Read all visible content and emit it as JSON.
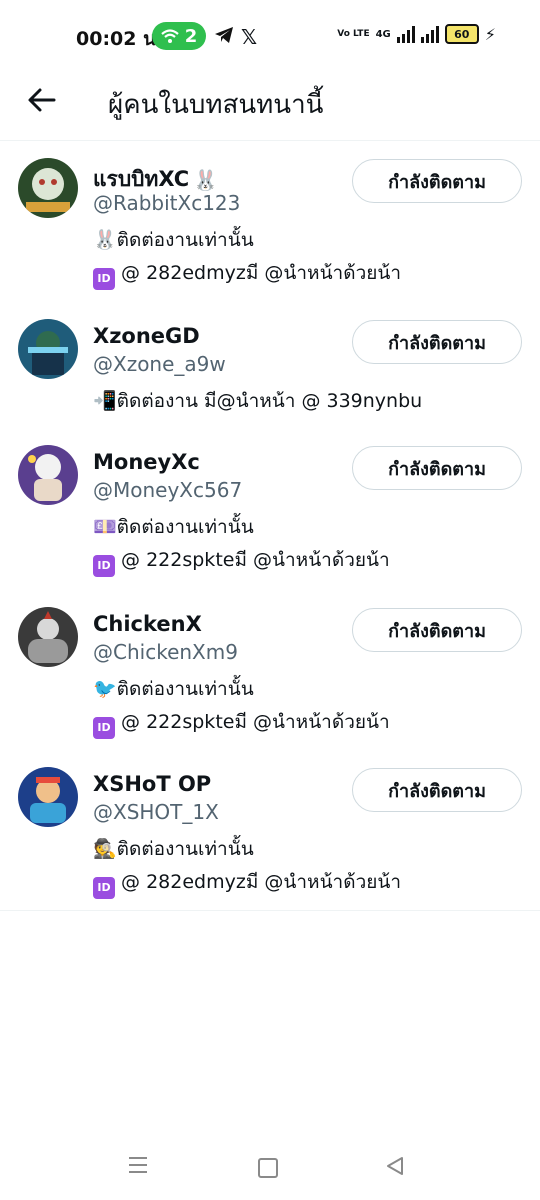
{
  "status_bar": {
    "time": "00:02 น.",
    "hotspot_count": "2",
    "volte": "Vo LTE",
    "network": "4G",
    "battery": "60"
  },
  "header": {
    "title": "ผู้คนในบทสนทนานี้"
  },
  "users": [
    {
      "display_name": "แรบบิทXC",
      "name_emoji": "🐰",
      "handle": "@RabbitXc123",
      "bio_line1": "🐰ติดต่องานเท่านั้น",
      "bio_line2_badge": "ID",
      "bio_line2": "@ 282edmyzมี @นำหน้าด้วยน้า",
      "button": "กำลังติดตาม",
      "avatar_color": "#2b4a2a"
    },
    {
      "display_name": "XzoneGD",
      "name_emoji": "",
      "handle": "@Xzone_a9w",
      "bio_line1": "📲ติดต่องาน มี@นำหน้า @ 339nynbu",
      "bio_line2_badge": "",
      "bio_line2": "",
      "button": "กำลังติดตาม",
      "avatar_color": "#1f5c7a"
    },
    {
      "display_name": "MoneyXc",
      "name_emoji": "",
      "handle": "@MoneyXc567",
      "bio_line1": "💷ติดต่องานเท่านั้น",
      "bio_line2_badge": "ID",
      "bio_line2": "@ 222spkteมี @นำหน้าด้วยน้า",
      "button": "กำลังติดตาม",
      "avatar_color": "#5a3f8f"
    },
    {
      "display_name": "ChickenX",
      "name_emoji": "",
      "handle": "@ChickenXm9",
      "bio_line1": "🐦ติดต่องานเท่านั้น",
      "bio_line2_badge": "ID",
      "bio_line2": "@ 222spkteมี @นำหน้าด้วยน้า",
      "button": "กำลังติดตาม",
      "avatar_color": "#3a3a3a"
    },
    {
      "display_name": "XSHoT OP",
      "name_emoji": "",
      "handle": "@XSHOT_1X",
      "bio_line1": "🕵️ติดต่องานเท่านั้น",
      "bio_line2_badge": "ID",
      "bio_line2": "@ 282edmyzมี @นำหน้าด้วยน้า",
      "button": "กำลังติดตาม",
      "avatar_color": "#1d3f8a"
    }
  ]
}
